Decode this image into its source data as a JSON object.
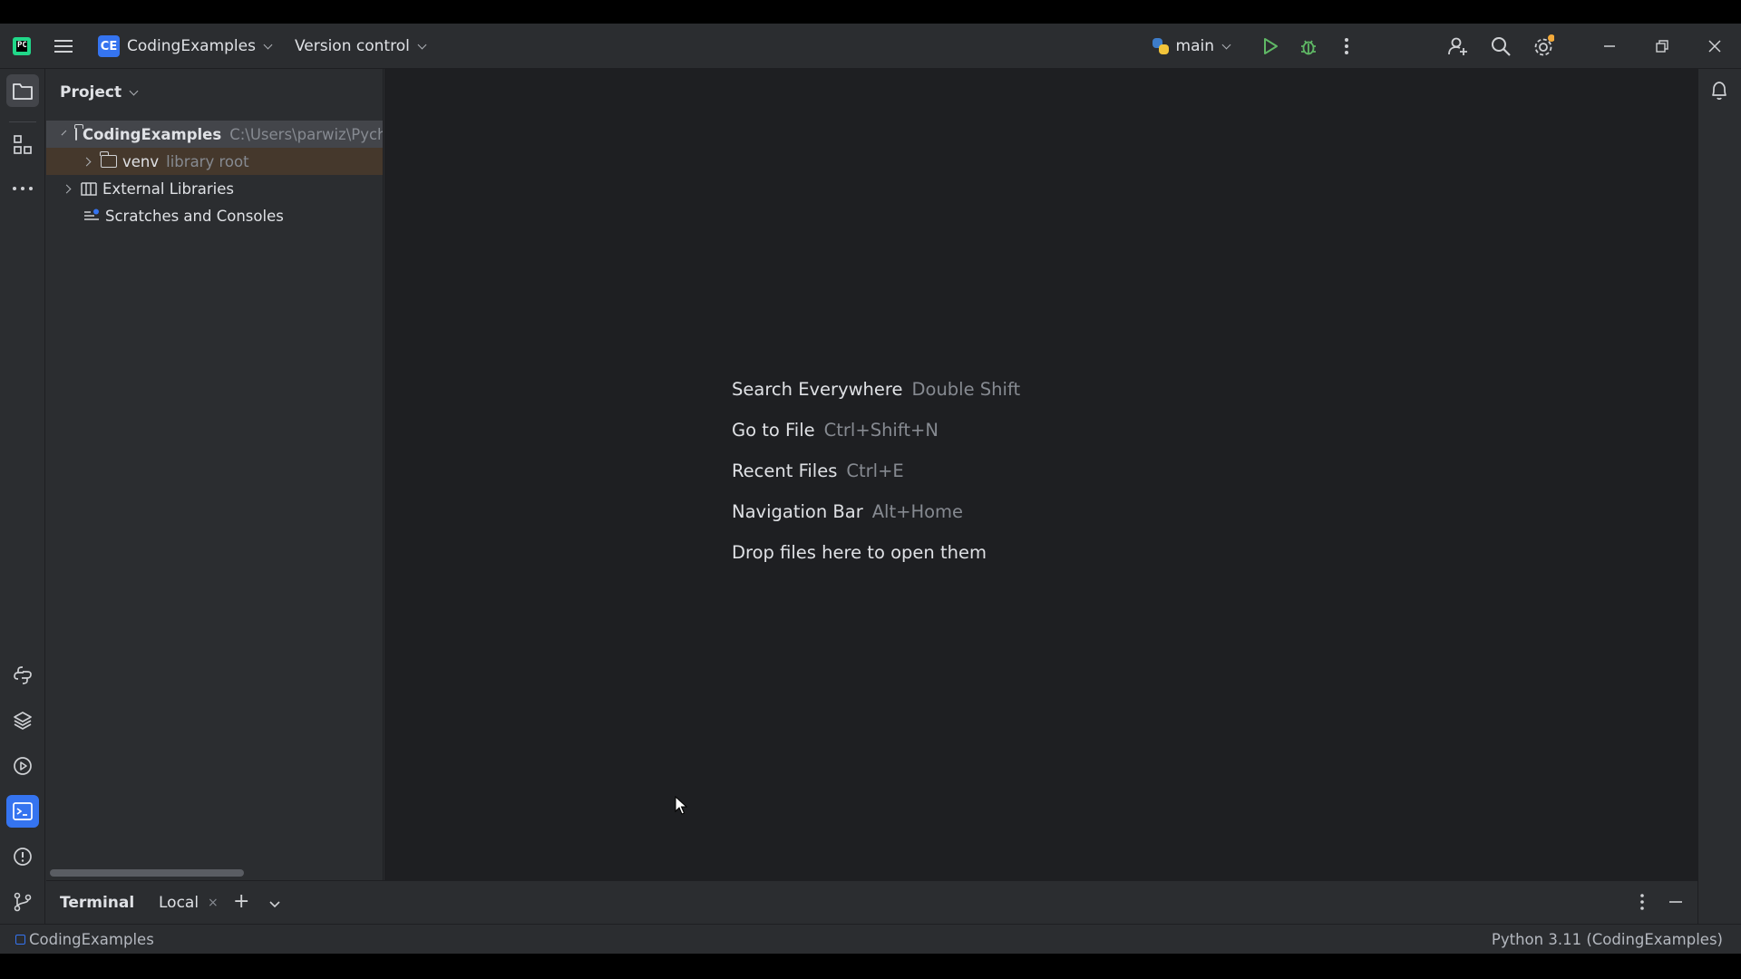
{
  "titlebar": {
    "project_badge": "CE",
    "project_name": "CodingExamples",
    "vcs_label": "Version control",
    "run_config": "main"
  },
  "project_panel": {
    "header": "Project",
    "tree": [
      {
        "label": "CodingExamples",
        "hint": "C:\\Users\\parwiz\\PycharmProjects\\CodingExamples"
      },
      {
        "label": "venv",
        "hint": "library root"
      },
      {
        "label": "External Libraries"
      },
      {
        "label": "Scratches and Consoles"
      }
    ]
  },
  "editor": {
    "hints": [
      {
        "action": "Search Everywhere",
        "key": "Double Shift"
      },
      {
        "action": "Go to File",
        "key": "Ctrl+Shift+N"
      },
      {
        "action": "Recent Files",
        "key": "Ctrl+E"
      },
      {
        "action": "Navigation Bar",
        "key": "Alt+Home"
      },
      {
        "action": "Drop files here to open them",
        "key": ""
      }
    ]
  },
  "terminal": {
    "title": "Terminal",
    "tab_label": "Local",
    "close_glyph": "×",
    "add_glyph": "+"
  },
  "statusbar": {
    "project": "CodingExamples",
    "interpreter": "Python 3.11 (CodingExamples)"
  },
  "colors": {
    "accent": "#3574f0",
    "run_green": "#5fb865",
    "panel_bg": "#2b2d30",
    "editor_bg": "#1e1f22"
  }
}
